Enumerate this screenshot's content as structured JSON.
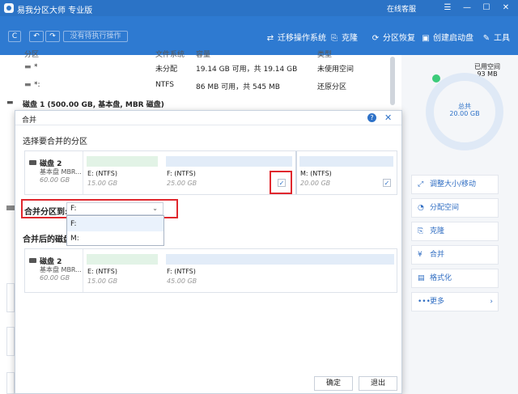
{
  "titlebar": {
    "app_title": "易我分区大师 专业版",
    "online": "在线客服"
  },
  "toolbar": {
    "refresh": "C",
    "undo": "↶",
    "redo": "↷",
    "pending": "没有待执行操作",
    "tools": [
      {
        "label": "迁移操作系统",
        "icon": "migrate-icon"
      },
      {
        "label": "克隆",
        "icon": "clone-icon"
      },
      {
        "label": "分区恢复",
        "icon": "recovery-icon"
      },
      {
        "label": "创建启动盘",
        "icon": "boot-disk-icon"
      },
      {
        "label": "工具",
        "icon": "wrench-icon"
      }
    ]
  },
  "table": {
    "headers": [
      "分区",
      "文件系统",
      "容量",
      "类型"
    ],
    "rows": [
      {
        "name": "*",
        "fs": "未分配",
        "cap": "19.14 GB 可用，共 19.14 GB",
        "type": "未使用空间"
      },
      {
        "name": "*:",
        "fs": "NTFS",
        "cap": "86 MB 可用，共 545 MB",
        "type": "还原分区"
      }
    ],
    "disk1": "磁盘 1 (500.00 GB, 基本盘, MBR 磁盘)"
  },
  "right": {
    "used_label": "已用空间",
    "used_value": "93 MB",
    "total_label": "总共",
    "total_value": "20.00 GB",
    "actions": [
      "调整大小/移动",
      "分配空间",
      "克隆",
      "合并",
      "格式化",
      "更多"
    ]
  },
  "dialog": {
    "title": "合并",
    "select_section": "选择要合并的分区",
    "disk_name": "磁盘 2",
    "disk_sub": "基本盘 MBR...",
    "disk_size": "60.00 GB",
    "partitions": [
      {
        "name": "E: (NTFS)",
        "size": "15.00 GB",
        "checked": false
      },
      {
        "name": "F: (NTFS)",
        "size": "25.00 GB",
        "checked": true
      },
      {
        "name": "M: (NTFS)",
        "size": "20.00 GB",
        "checked": true
      }
    ],
    "merge_to_label": "合并分区到:",
    "merge_to_value": "F:",
    "options": [
      "F:",
      "M:"
    ],
    "after_section": "合并后的磁盘",
    "after_partitions": [
      {
        "name": "E: (NTFS)",
        "size": "15.00 GB"
      },
      {
        "name": "F: (NTFS)",
        "size": "45.00 GB"
      }
    ],
    "ok": "确定",
    "cancel": "退出"
  }
}
